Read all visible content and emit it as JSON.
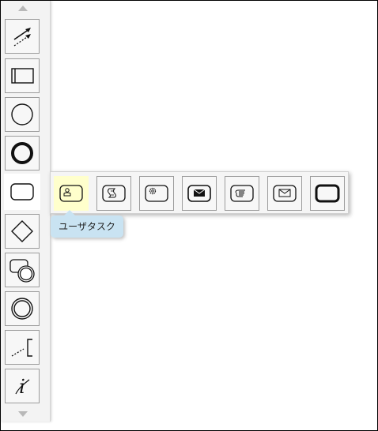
{
  "palette": {
    "tools": [
      {
        "icon": "connector-arrows-icon"
      },
      {
        "icon": "pool-lane-icon"
      },
      {
        "icon": "start-event-icon"
      },
      {
        "icon": "end-event-icon"
      },
      {
        "icon": "task-icon",
        "active": true
      },
      {
        "icon": "gateway-icon"
      },
      {
        "icon": "subprocess-icon"
      },
      {
        "icon": "intermediate-event-icon"
      },
      {
        "icon": "annotation-icon"
      },
      {
        "icon": "data-object-icon"
      }
    ]
  },
  "flyout": {
    "items": [
      {
        "icon": "user-task-icon",
        "highlighted": true
      },
      {
        "icon": "script-task-icon"
      },
      {
        "icon": "service-task-icon"
      },
      {
        "icon": "send-task-icon"
      },
      {
        "icon": "manual-task-icon"
      },
      {
        "icon": "receive-task-icon"
      },
      {
        "icon": "call-activity-icon"
      }
    ]
  },
  "tooltip": {
    "text": "ユーザタスク"
  }
}
